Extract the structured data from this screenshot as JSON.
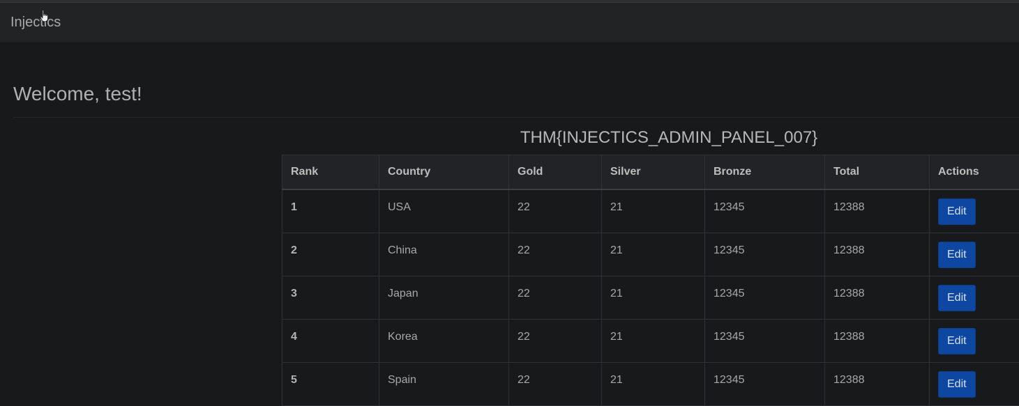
{
  "navbar": {
    "brand": "Injectics"
  },
  "main": {
    "welcome": "Welcome, test!",
    "flag": "THM{INJECTICS_ADMIN_PANEL_007}"
  },
  "table": {
    "headers": [
      "Rank",
      "Country",
      "Gold",
      "Silver",
      "Bronze",
      "Total",
      "Actions"
    ],
    "rows": [
      {
        "rank": "1",
        "country": "USA",
        "gold": "22",
        "silver": "21",
        "bronze": "12345",
        "total": "12388",
        "action": "Edit"
      },
      {
        "rank": "2",
        "country": "China",
        "gold": "22",
        "silver": "21",
        "bronze": "12345",
        "total": "12388",
        "action": "Edit"
      },
      {
        "rank": "3",
        "country": "Japan",
        "gold": "22",
        "silver": "21",
        "bronze": "12345",
        "total": "12388",
        "action": "Edit"
      },
      {
        "rank": "4",
        "country": "Korea",
        "gold": "22",
        "silver": "21",
        "bronze": "12345",
        "total": "12388",
        "action": "Edit"
      },
      {
        "rank": "5",
        "country": "Spain",
        "gold": "22",
        "silver": "21",
        "bronze": "12345",
        "total": "12388",
        "action": "Edit"
      }
    ]
  },
  "colors": {
    "background": "#18191b",
    "navbar": "#222325",
    "button": "#0d47a1"
  },
  "icons": {
    "cursor": "hand-pointer-icon"
  }
}
